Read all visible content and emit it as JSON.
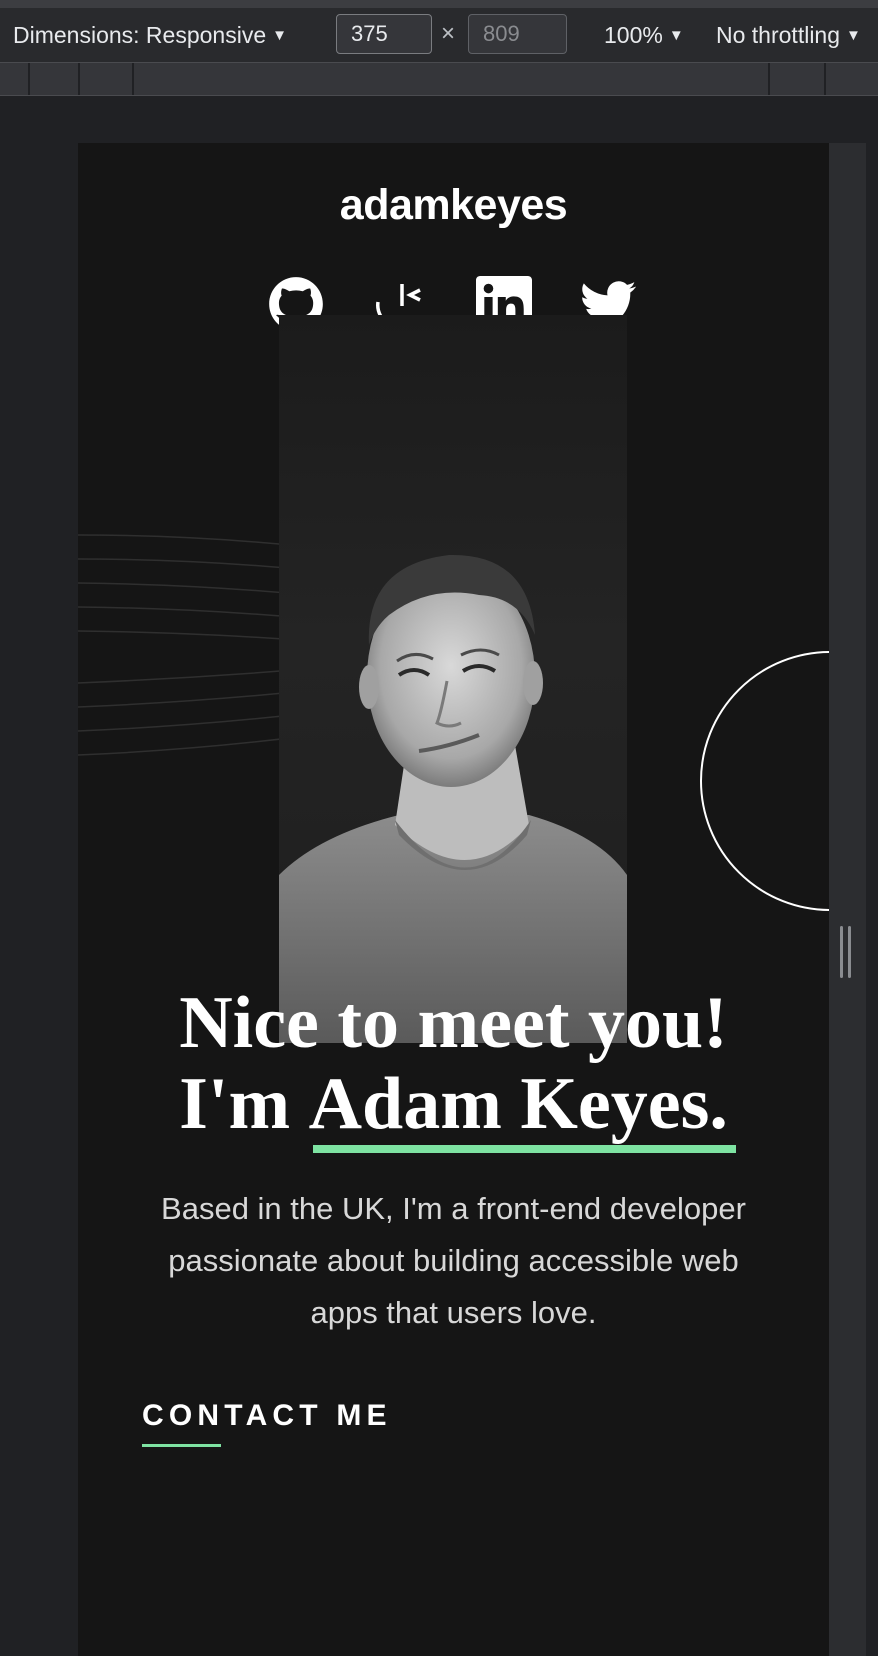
{
  "devtools": {
    "dimensions_label": "Dimensions: Responsive",
    "width_value": "375",
    "height_placeholder": "809",
    "times_symbol": "×",
    "zoom": "100%",
    "throttling": "No throttling",
    "caret": "▼"
  },
  "site": {
    "brand": "adamkeyes",
    "social_links": [
      {
        "name": "github-icon"
      },
      {
        "name": "frontend-mentor-icon"
      },
      {
        "name": "linkedin-icon"
      },
      {
        "name": "twitter-icon"
      }
    ],
    "headline_line1": "Nice to meet you!",
    "headline_line2_prefix": "I'm ",
    "headline_name": "Adam Keyes.",
    "bio": "Based in the UK, I'm a front-end developer passionate about building accessible web apps that users love.",
    "cta": "CONTACT ME"
  },
  "colors": {
    "accent": "#7ee3a2",
    "page_bg": "#151515",
    "devtools_bg": "#292a2d"
  }
}
